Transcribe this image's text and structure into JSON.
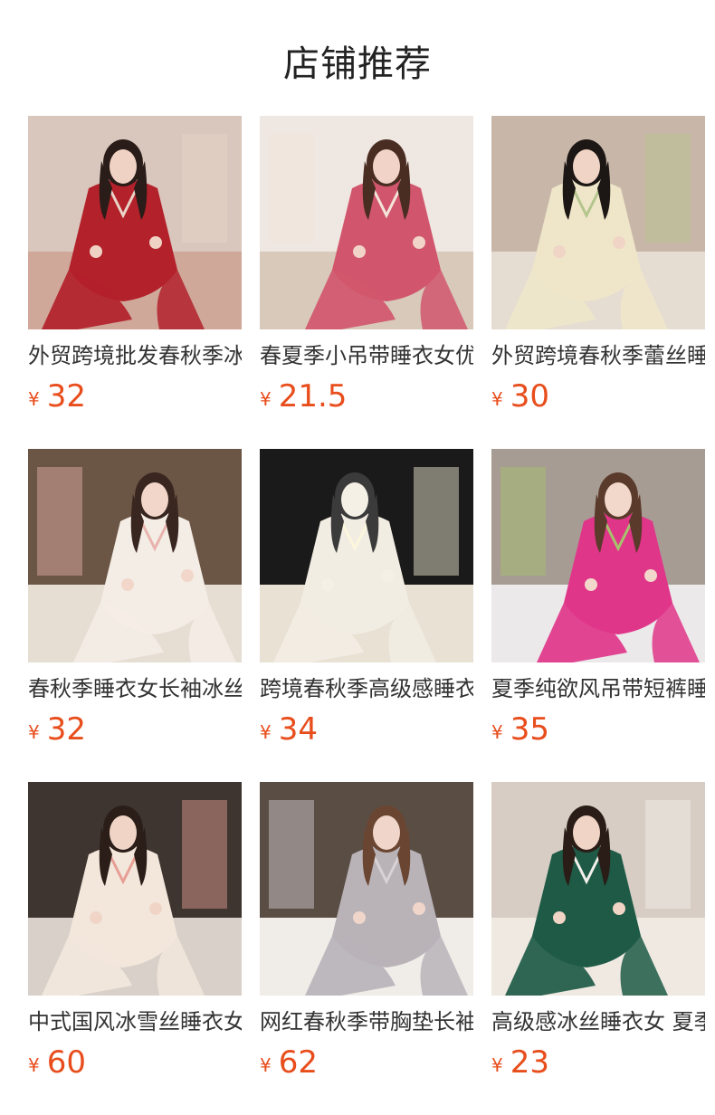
{
  "header": {
    "title": "店铺推荐"
  },
  "colors": {
    "price": "#e84d1c",
    "title_text": "#333333"
  },
  "products": [
    {
      "title": "外贸跨境批发春秋季冰丝睡衣女",
      "currency": "¥",
      "price": "32",
      "image": "red-satin-pajama-photo",
      "palette": {
        "bg": "#d9c6bd",
        "floor": "#cfa89a",
        "garment": "#b3212b",
        "accent": "#e9d4c8",
        "skin": "#efd2c4",
        "hair": "#2a1c18"
      }
    },
    {
      "title": "春夏季小吊带睡衣女优雅",
      "currency": "¥",
      "price": "21.5",
      "image": "pink-floral-robe-photo",
      "palette": {
        "bg": "#efe7e2",
        "floor": "#d8c9bb",
        "garment": "#d1566d",
        "accent": "#f3e5da",
        "skin": "#f1d4c7",
        "hair": "#4a2d22"
      }
    },
    {
      "title": "外贸跨境春秋季蕾丝睡衣套装",
      "currency": "¥",
      "price": "30",
      "image": "champagne-lace-set-photo",
      "palette": {
        "bg": "#c8b7a8",
        "floor": "#e6ddd2",
        "garment": "#efe6c9",
        "accent": "#b4c58d",
        "skin": "#f0d4c5",
        "hair": "#1c1614"
      }
    },
    {
      "title": "春秋季睡衣女长袖冰丝套装",
      "currency": "¥",
      "price": "32",
      "image": "white-satin-pajama-photo",
      "palette": {
        "bg": "#6b5544",
        "floor": "#e6ddd3",
        "garment": "#f4ede6",
        "accent": "#e8b3ad",
        "skin": "#f1d6c9",
        "hair": "#3a2620"
      }
    },
    {
      "title": "跨境春秋季高级感睡衣礼盒装",
      "currency": "¥",
      "price": "34",
      "image": "boxed-pajama-bow-photo",
      "palette": {
        "bg": "#1a1a1a",
        "floor": "#e8e1d4",
        "garment": "#f2ede3",
        "accent": "#fbf6dc",
        "skin": "#f5f0e6",
        "hair": "#3b3b3b"
      }
    },
    {
      "title": "夏季纯欲风吊带短裤睡衣套装",
      "currency": "¥",
      "price": "35",
      "image": "pink-floral-cami-photo",
      "palette": {
        "bg": "#a79c93",
        "floor": "#ece9ea",
        "garment": "#e0368a",
        "accent": "#a5c46c",
        "skin": "#f2d7cb",
        "hair": "#5a3a2a"
      }
    },
    {
      "title": "中式国风冰雪丝睡衣女长袖",
      "currency": "¥",
      "price": "60",
      "image": "chinese-style-pajama-photo",
      "palette": {
        "bg": "#3e3530",
        "floor": "#d8d0c9",
        "garment": "#f3e7dc",
        "accent": "#e79f95",
        "skin": "#f0d5c7",
        "hair": "#2b1e18"
      }
    },
    {
      "title": "网红春秋季带胸垫长袖睡裙",
      "currency": "¥",
      "price": "62",
      "image": "grey-lace-nightgown-photo",
      "palette": {
        "bg": "#5a4d44",
        "floor": "#f0ede9",
        "garment": "#b9b3b8",
        "accent": "#d8d2d6",
        "skin": "#f0d6ca",
        "hair": "#6a4632"
      }
    },
    {
      "title": "高级感冰丝睡衣女 夏季短袖",
      "currency": "¥",
      "price": "23",
      "image": "green-print-pajama-photo",
      "palette": {
        "bg": "#d7cdc4",
        "floor": "#efe9e2",
        "garment": "#1e5a46",
        "accent": "#f4f1ec",
        "skin": "#f0d4c5",
        "hair": "#2a1d18"
      }
    }
  ]
}
